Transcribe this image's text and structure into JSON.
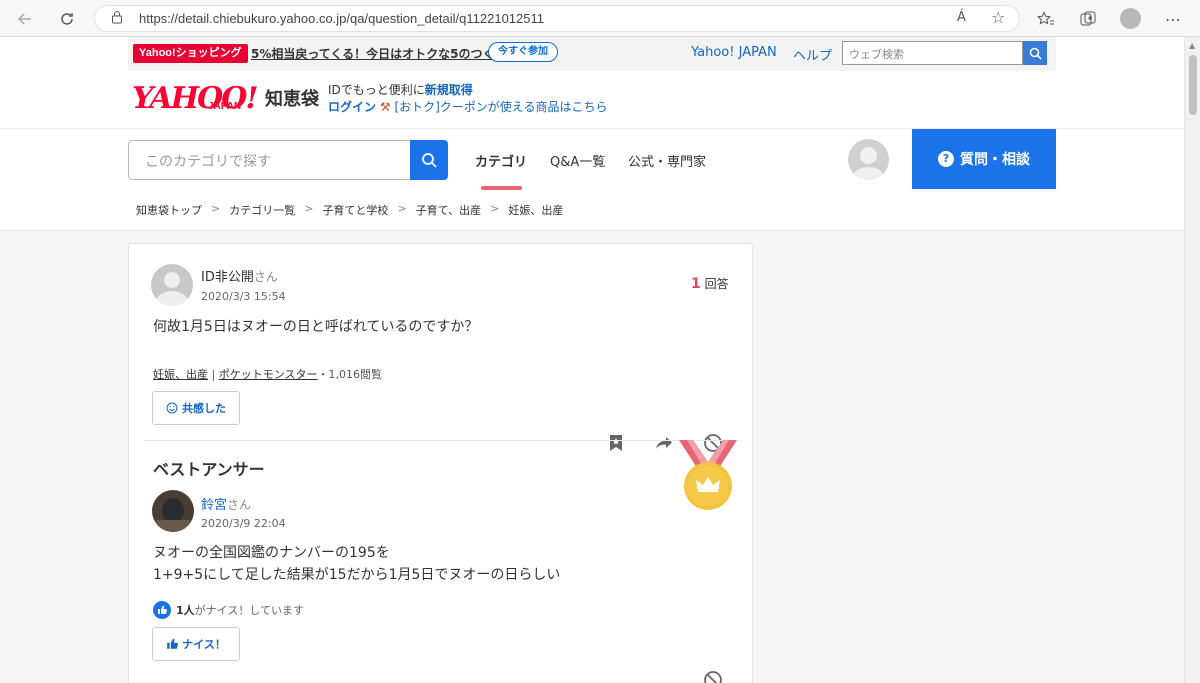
{
  "browser": {
    "url": "https://detail.chiebukuro.yahoo.co.jp/qa/question_detail/q11221012511",
    "read_aloud_label": "Á"
  },
  "promo": {
    "tag": "Yahoo!ショッピング",
    "text": "5%相当戻ってくる！今日はオトクな5のつく日",
    "button": "今すぐ参加"
  },
  "top_links": {
    "yahoo_japan": "Yahoo! JAPAN",
    "help": "ヘルプ",
    "web_search_placeholder": "ウェブ検索"
  },
  "logo": {
    "yahoo": "YAHOO!",
    "japan": "JAPAN",
    "chiebukuro": "知恵袋"
  },
  "login": {
    "line1_prefix": "IDでもっと便利に",
    "line1_link": "新規取得",
    "login_label": "ログイン",
    "coupon": "[おトク]クーポンが使える商品はこちら"
  },
  "nav": {
    "search_placeholder": "このカテゴリで探す",
    "tabs": [
      "カテゴリ",
      "Q&A一覧",
      "公式・専門家"
    ],
    "ask_button": "質問・相談"
  },
  "breadcrumb": [
    "知恵袋トップ",
    "カテゴリ一覧",
    "子育てと学校",
    "子育て、出産",
    "妊娠、出産"
  ],
  "question": {
    "user": "ID非公開",
    "honorific": "さん",
    "date": "2020/3/3 15:54",
    "answer_count": "1",
    "answer_count_suffix": "回答",
    "text": "何故1月5日はヌオーの日と呼ばれているのですか？",
    "tag1": "妊娠、出産",
    "tag_sep": "|",
    "tag2": "ポケットモンスター",
    "views": "・1,016閲覧",
    "empathy_button": "共感した"
  },
  "best_answer": {
    "title": "ベストアンサー",
    "user": "鈴宮",
    "honorific": "さん",
    "date": "2020/3/9 22:04",
    "line1": "ヌオーの全国図鑑のナンバーの195を",
    "line2": "1+9+5にして足した結果が15だから1月5日でヌオーの日らしい",
    "nice_count": "1人",
    "nice_suffix": "がナイス！しています",
    "nice_button": "ナイス！"
  },
  "colors": {
    "accent_blue": "#1a73e8",
    "link_blue": "#1466c4",
    "yahoo_red": "#ff0033",
    "medal_gold": "#f5c342",
    "ribbon_red": "#e86674"
  }
}
